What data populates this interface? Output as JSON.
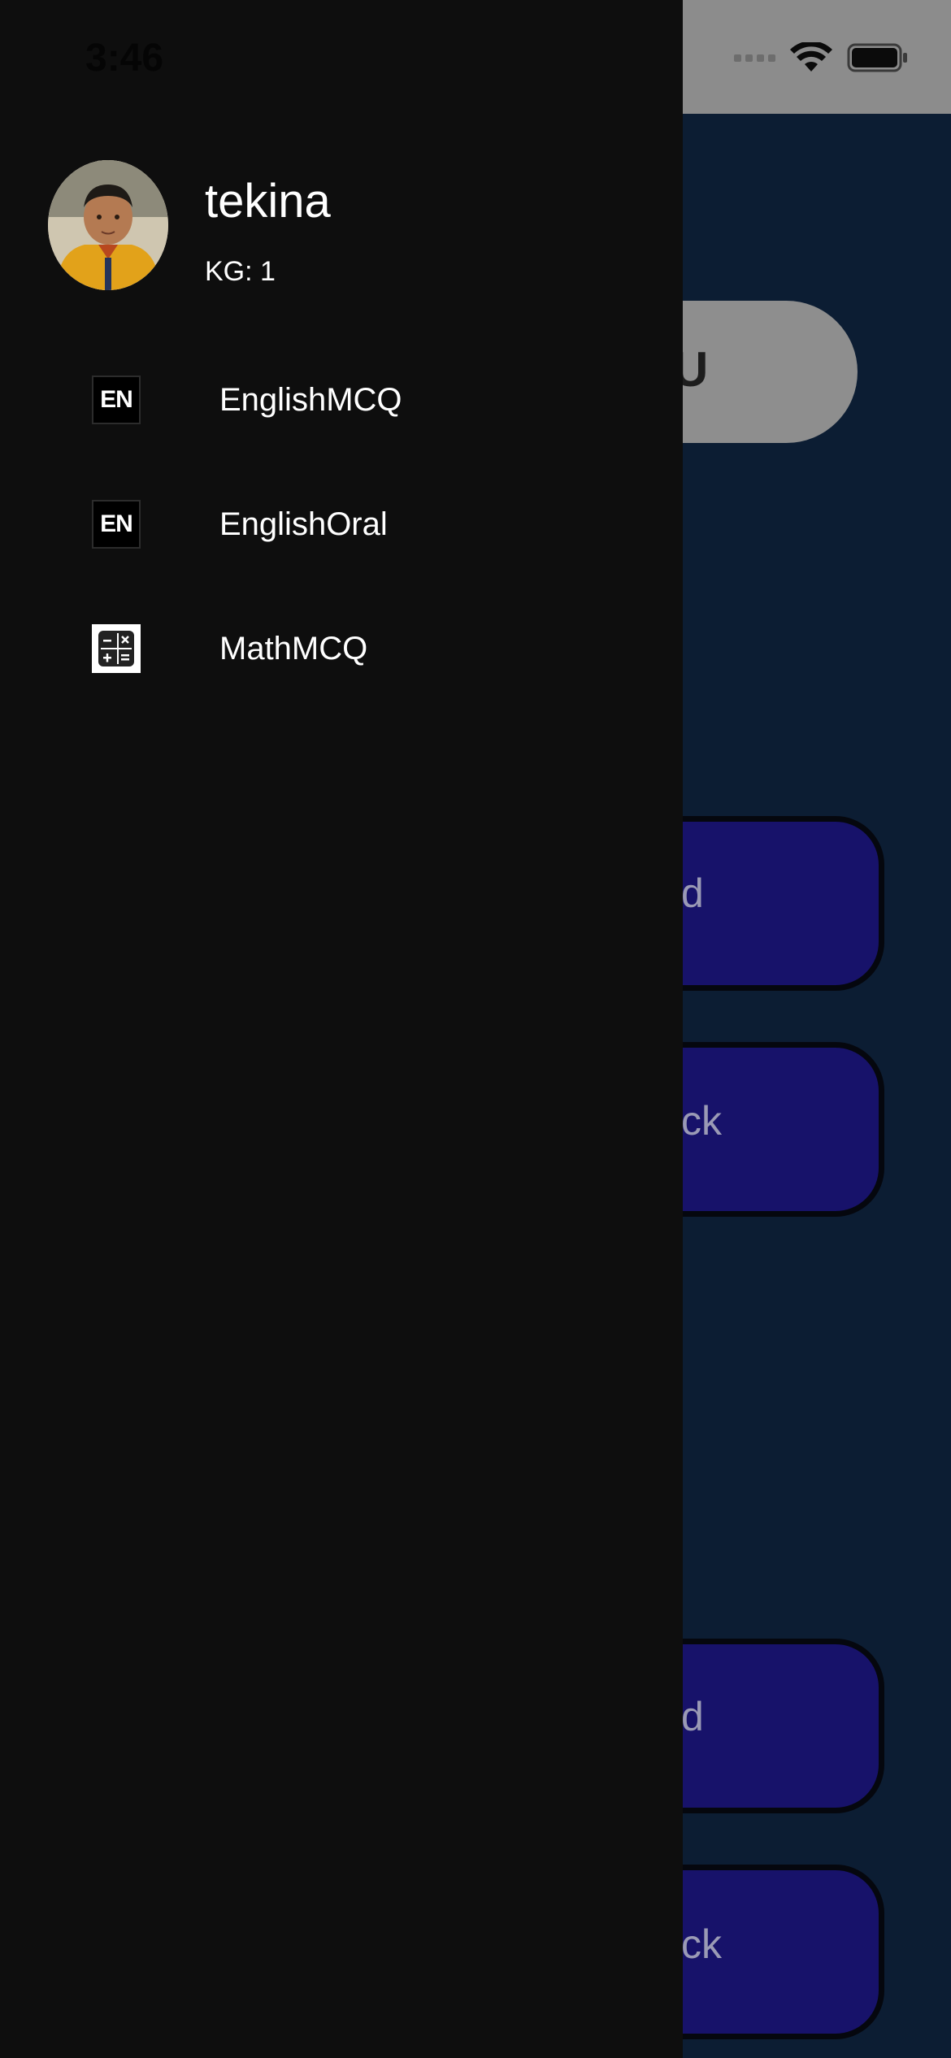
{
  "status_bar": {
    "time": "3:46"
  },
  "background": {
    "pill_text": "U",
    "cards": [
      {
        "text": "d"
      },
      {
        "text": "ck"
      },
      {
        "text": "d"
      },
      {
        "text": "ck"
      }
    ]
  },
  "drawer": {
    "user": {
      "name": "tekina",
      "grade": "KG: 1"
    },
    "items": [
      {
        "label": "EnglishMCQ",
        "icon_text": "EN",
        "icon": "english-icon"
      },
      {
        "label": "EnglishOral",
        "icon_text": "EN",
        "icon": "english-icon"
      },
      {
        "label": "MathMCQ",
        "icon": "calculator-icon"
      }
    ]
  },
  "colors": {
    "drawer_bg": "#0e0e0e",
    "app_bg": "#0c1d33",
    "card_bg": "#17126a",
    "status_bar_bg": "#8c8c8c"
  }
}
